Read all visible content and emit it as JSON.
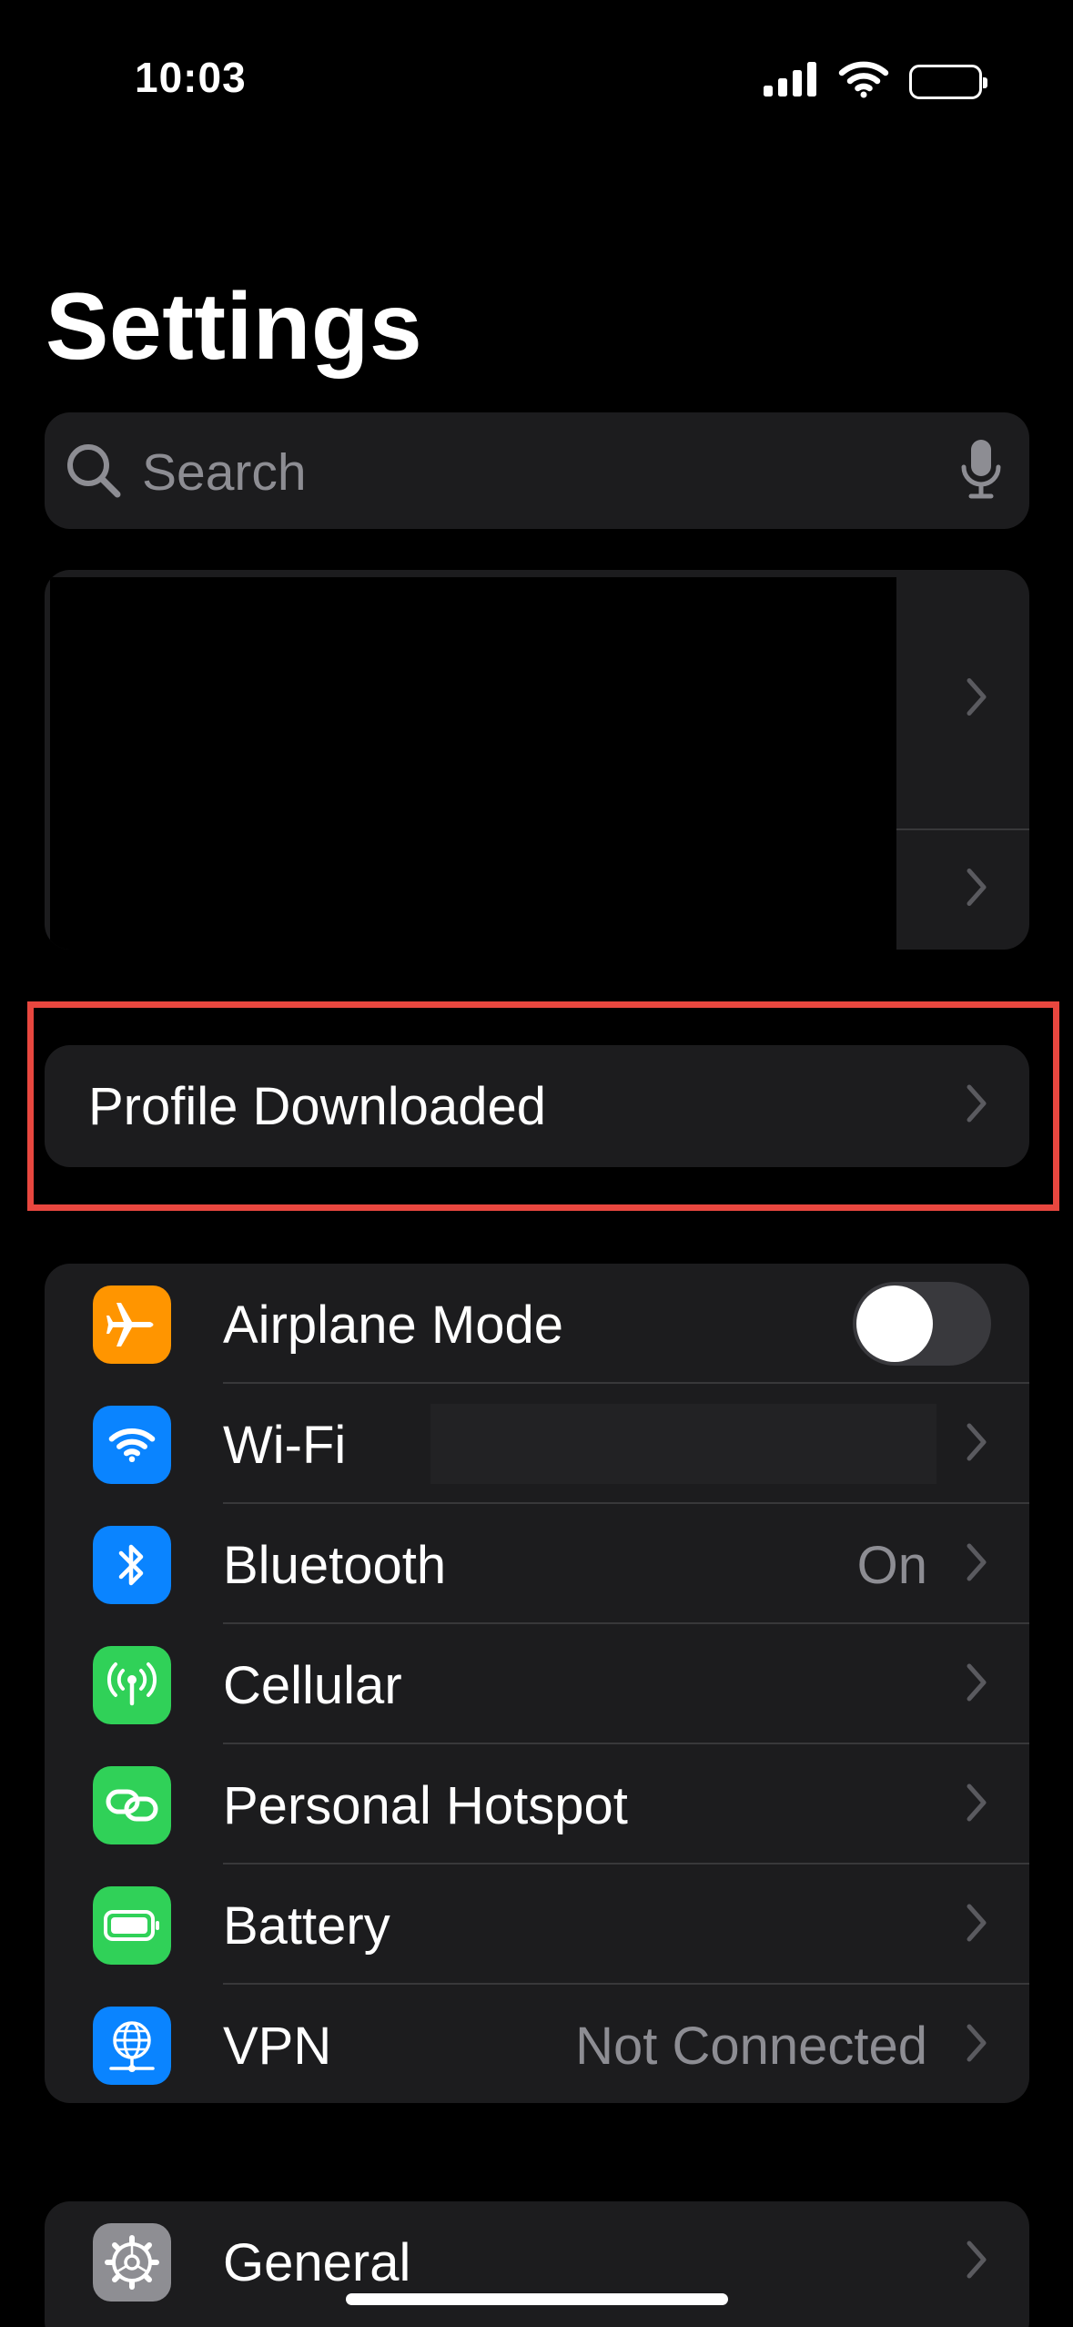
{
  "status_bar": {
    "time": "10:03"
  },
  "header": {
    "title": "Settings"
  },
  "search": {
    "placeholder": "Search"
  },
  "profile_banner": {
    "label": "Profile Downloaded"
  },
  "network_section": {
    "rows": [
      {
        "label": "Airplane Mode",
        "icon": "airplane-icon",
        "icon_color": "#ff9500",
        "toggle_on": false
      },
      {
        "label": "Wi-Fi",
        "icon": "wifi-icon",
        "icon_color": "#0a84ff"
      },
      {
        "label": "Bluetooth",
        "value": "On",
        "icon": "bluetooth-icon",
        "icon_color": "#0a84ff"
      },
      {
        "label": "Cellular",
        "icon": "cellular-antenna-icon",
        "icon_color": "#30d158"
      },
      {
        "label": "Personal Hotspot",
        "icon": "hotspot-link-icon",
        "icon_color": "#30d158"
      },
      {
        "label": "Battery",
        "icon": "battery-icon",
        "icon_color": "#30d158"
      },
      {
        "label": "VPN",
        "value": "Not Connected",
        "icon": "vpn-globe-icon",
        "icon_color": "#0a84ff"
      }
    ]
  },
  "general_section": {
    "rows": [
      {
        "label": "General",
        "icon": "gear-icon",
        "icon_color": "#8e8e93"
      }
    ]
  },
  "colors": {
    "background": "#000000",
    "card": "#1c1c1e",
    "separator": "#38383a",
    "secondary_text": "#8d8d93",
    "highlight_outline": "#e8473f"
  }
}
